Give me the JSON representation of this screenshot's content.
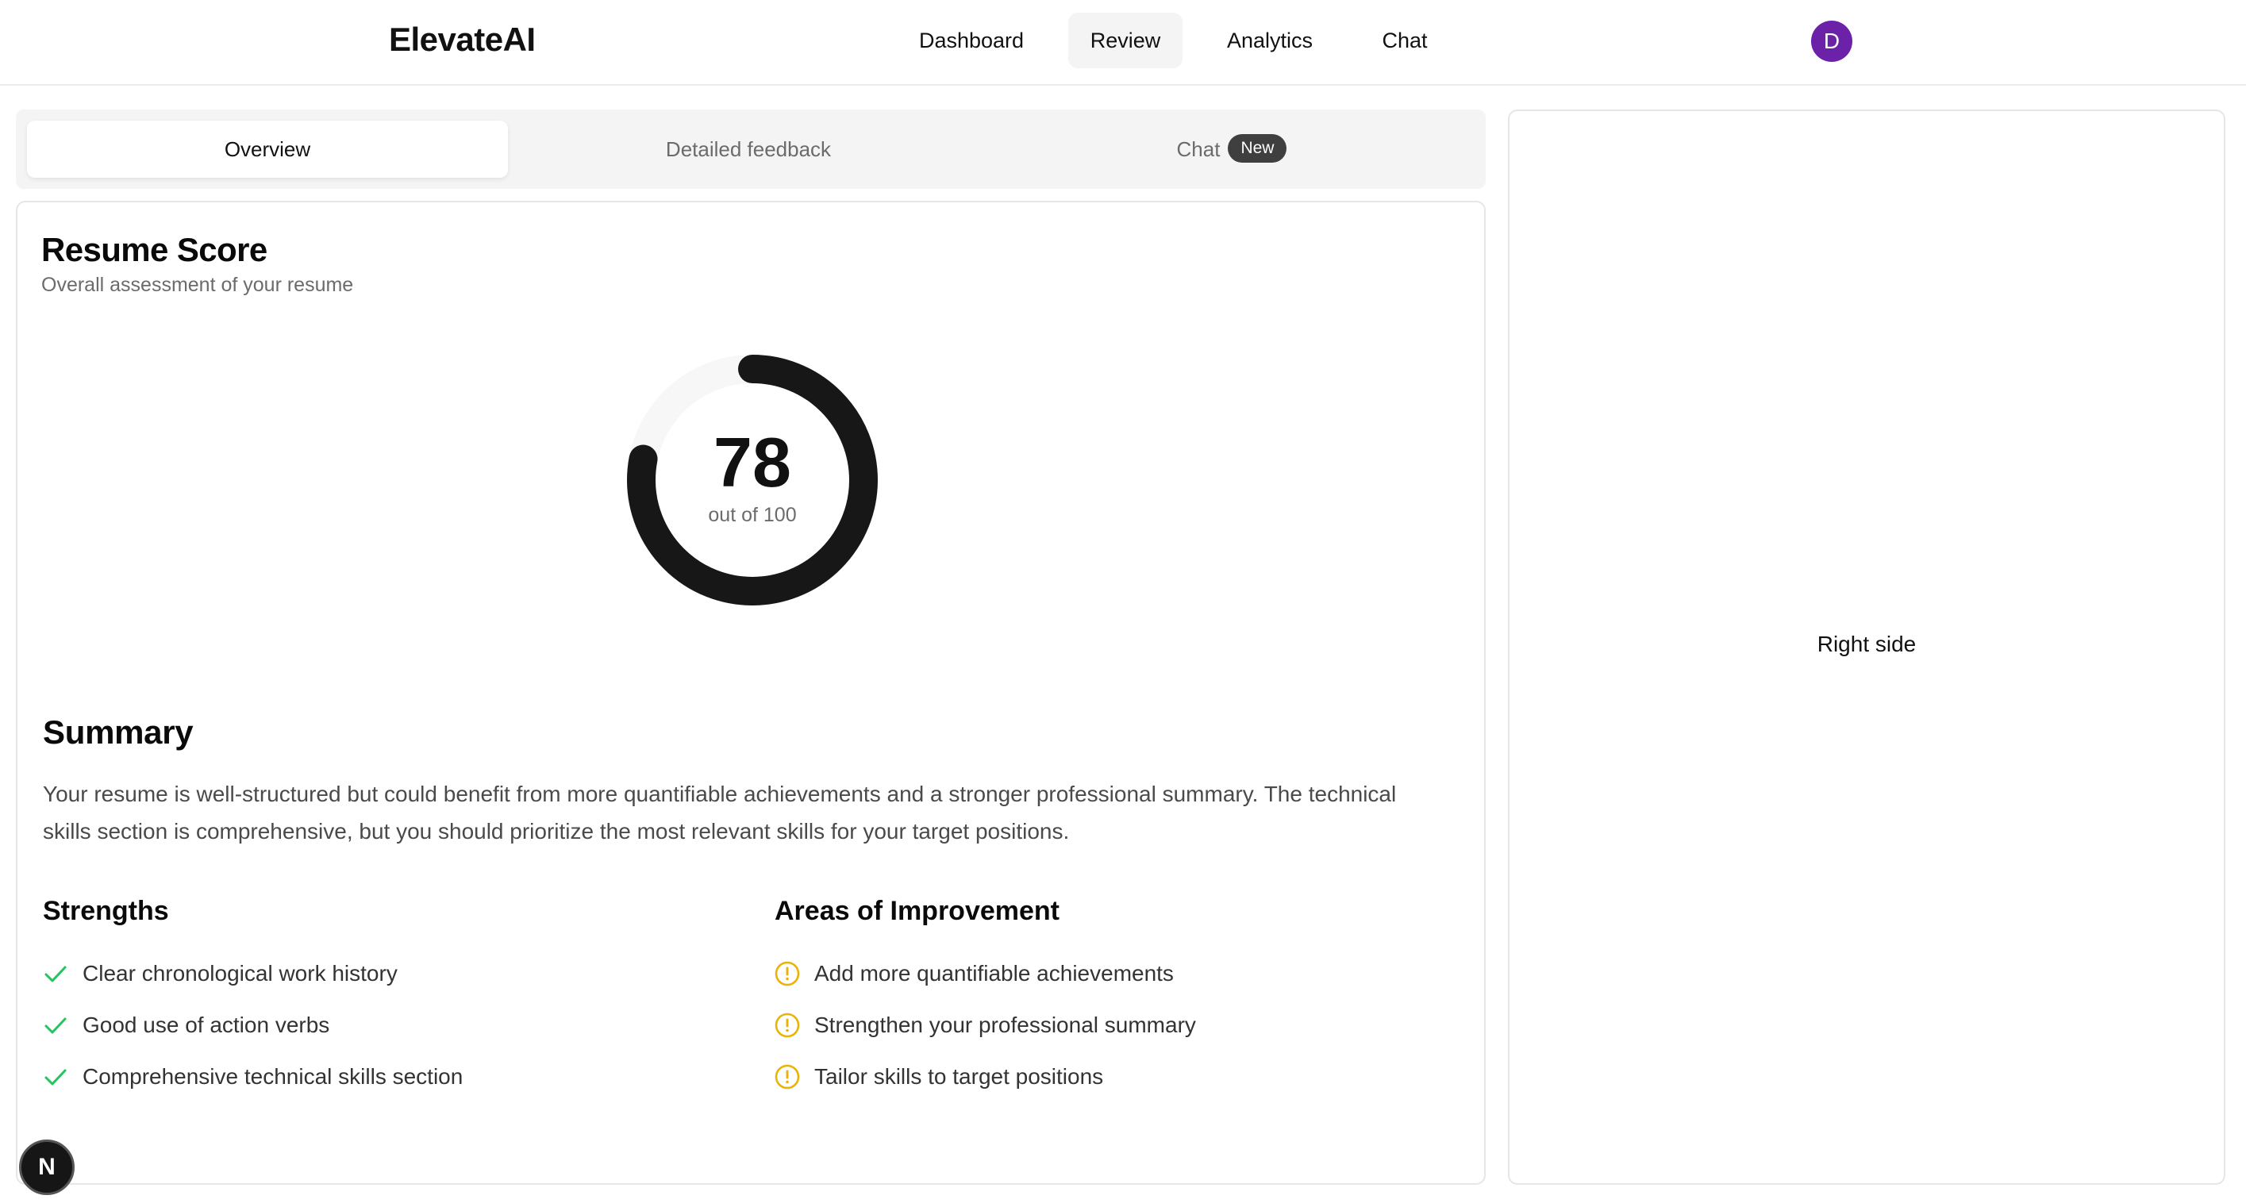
{
  "app": {
    "logo": "ElevateAI"
  },
  "nav": {
    "items": [
      {
        "label": "Dashboard",
        "active": false
      },
      {
        "label": "Review",
        "active": true
      },
      {
        "label": "Analytics",
        "active": false
      },
      {
        "label": "Chat",
        "active": false
      }
    ],
    "avatar_initial": "D",
    "avatar_color": "#6b21a8"
  },
  "tabs": {
    "items": [
      {
        "label": "Overview",
        "active": true
      },
      {
        "label": "Detailed feedback",
        "active": false
      },
      {
        "label": "Chat",
        "badge": "New",
        "active": false
      }
    ]
  },
  "score_card": {
    "title": "Resume Score",
    "subtitle": "Overall assessment of your resume",
    "score": "78",
    "score_fraction": 0.78,
    "out_of": "out of 100"
  },
  "summary": {
    "heading": "Summary",
    "text": "Your resume is well-structured but could benefit from more quantifiable achievements and a stronger professional summary. The technical skills section is comprehensive, but you should prioritize the most relevant skills for your target positions."
  },
  "strengths": {
    "heading": "Strengths",
    "icon": "check-icon",
    "icon_color": "#22c55e",
    "items": [
      "Clear chronological work history",
      "Good use of action verbs",
      "Comprehensive technical skills section"
    ]
  },
  "improvements": {
    "heading": "Areas of Improvement",
    "icon": "alert-circle-icon",
    "icon_color": "#eab308",
    "items": [
      "Add more quantifiable achievements",
      "Strengthen your professional summary",
      "Tailor skills to target positions"
    ]
  },
  "right_panel": {
    "text": "Right side"
  },
  "dev_badge": {
    "label": "N"
  }
}
